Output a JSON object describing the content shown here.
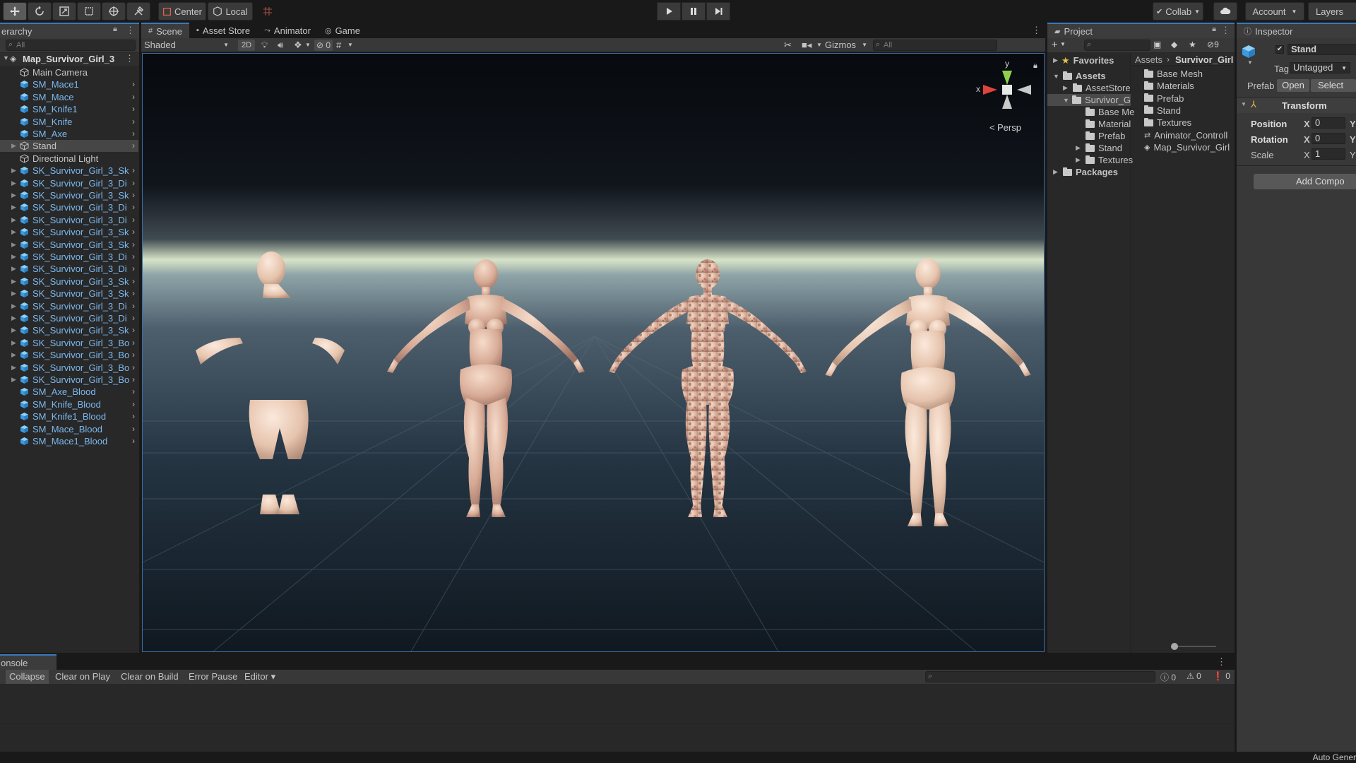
{
  "toolbar": {
    "center_label": "Center",
    "local_label": "Local",
    "collab_label": "Collab",
    "account_label": "Account",
    "layers_label": "Layers"
  },
  "hierarchy": {
    "tab_label": "erarchy",
    "search_placeholder": "All",
    "scene_name": "Map_Survivor_Girl_3",
    "items": [
      {
        "label": "Main Camera",
        "blue": false,
        "expand": false,
        "arrow": false
      },
      {
        "label": "SM_Mace1",
        "blue": true,
        "expand": false,
        "arrow": true
      },
      {
        "label": "SM_Mace",
        "blue": true,
        "expand": false,
        "arrow": true
      },
      {
        "label": "SM_Knife1",
        "blue": true,
        "expand": false,
        "arrow": true
      },
      {
        "label": "SM_Knife",
        "blue": true,
        "expand": false,
        "arrow": true
      },
      {
        "label": "SM_Axe",
        "blue": true,
        "expand": false,
        "arrow": true
      },
      {
        "label": "Stand",
        "blue": false,
        "expand": true,
        "arrow": true,
        "selected": true
      },
      {
        "label": "Directional Light",
        "blue": false,
        "expand": false,
        "arrow": false
      },
      {
        "label": "SK_Survivor_Girl_3_Sk",
        "blue": true,
        "expand": true,
        "arrow": true
      },
      {
        "label": "SK_Survivor_Girl_3_Di",
        "blue": true,
        "expand": true,
        "arrow": true
      },
      {
        "label": "SK_Survivor_Girl_3_Sk",
        "blue": true,
        "expand": true,
        "arrow": true
      },
      {
        "label": "SK_Survivor_Girl_3_Di",
        "blue": true,
        "expand": true,
        "arrow": true
      },
      {
        "label": "SK_Survivor_Girl_3_Di",
        "blue": true,
        "expand": true,
        "arrow": true
      },
      {
        "label": "SK_Survivor_Girl_3_Sk",
        "blue": true,
        "expand": true,
        "arrow": true
      },
      {
        "label": "SK_Survivor_Girl_3_Sk",
        "blue": true,
        "expand": true,
        "arrow": true
      },
      {
        "label": "SK_Survivor_Girl_3_Di",
        "blue": true,
        "expand": true,
        "arrow": true
      },
      {
        "label": "SK_Survivor_Girl_3_Di",
        "blue": true,
        "expand": true,
        "arrow": true
      },
      {
        "label": "SK_Survivor_Girl_3_Sk",
        "blue": true,
        "expand": true,
        "arrow": true
      },
      {
        "label": "SK_Survivor_Girl_3_Sk",
        "blue": true,
        "expand": true,
        "arrow": true
      },
      {
        "label": "SK_Survivor_Girl_3_Di",
        "blue": true,
        "expand": true,
        "arrow": true
      },
      {
        "label": "SK_Survivor_Girl_3_Di",
        "blue": true,
        "expand": true,
        "arrow": true
      },
      {
        "label": "SK_Survivor_Girl_3_Sk",
        "blue": true,
        "expand": true,
        "arrow": true
      },
      {
        "label": "SK_Survivor_Girl_3_Bo",
        "blue": true,
        "expand": true,
        "arrow": true
      },
      {
        "label": "SK_Survivor_Girl_3_Bo",
        "blue": true,
        "expand": true,
        "arrow": true
      },
      {
        "label": "SK_Survivor_Girl_3_Bo",
        "blue": true,
        "expand": true,
        "arrow": true
      },
      {
        "label": "SK_Survivor_Girl_3_Bo",
        "blue": true,
        "expand": true,
        "arrow": true
      },
      {
        "label": "SM_Axe_Blood",
        "blue": true,
        "expand": false,
        "arrow": true
      },
      {
        "label": "SM_Knife_Blood",
        "blue": true,
        "expand": false,
        "arrow": true
      },
      {
        "label": "SM_Knife1_Blood",
        "blue": true,
        "expand": false,
        "arrow": true
      },
      {
        "label": "SM_Mace_Blood",
        "blue": true,
        "expand": false,
        "arrow": true
      },
      {
        "label": "SM_Mace1_Blood",
        "blue": true,
        "expand": false,
        "arrow": true
      }
    ]
  },
  "scene": {
    "tabs": [
      {
        "label": "Scene",
        "icon": "#",
        "selected": true
      },
      {
        "label": "Asset Store",
        "icon": "▪",
        "selected": false
      },
      {
        "label": "Animator",
        "icon": "⤳",
        "selected": false
      },
      {
        "label": "Game",
        "icon": "◎",
        "selected": false
      }
    ],
    "shading_mode": "Shaded",
    "mode_2d": "2D",
    "hidden_count": "0",
    "gizmos_label": "Gizmos",
    "search_placeholder": "All",
    "gizmo_y": "y",
    "gizmo_x": "x",
    "persp_label": "Persp"
  },
  "project": {
    "tab_label": "Project",
    "hidden_count": "9",
    "favorites_label": "Favorites",
    "tree": [
      {
        "label": "Assets",
        "bold": true
      },
      {
        "label": "AssetStore",
        "bold": false
      },
      {
        "label": "Survivor_G",
        "bold": false,
        "selected": true
      },
      {
        "label": "Base Me",
        "bold": false
      },
      {
        "label": "Material",
        "bold": false
      },
      {
        "label": "Prefab",
        "bold": false
      },
      {
        "label": "Stand",
        "bold": false
      },
      {
        "label": "Textures",
        "bold": false
      },
      {
        "label": "Packages",
        "bold": true
      }
    ],
    "breadcrumb_root": "Assets",
    "breadcrumb_current": "Survivor_Girl",
    "files": [
      {
        "label": "Base Mesh",
        "kind": "folder"
      },
      {
        "label": "Materials",
        "kind": "folder"
      },
      {
        "label": "Prefab",
        "kind": "folder"
      },
      {
        "label": "Stand",
        "kind": "folder"
      },
      {
        "label": "Textures",
        "kind": "folder"
      },
      {
        "label": "Animator_Controll",
        "kind": "animator"
      },
      {
        "label": "Map_Survivor_Girl",
        "kind": "scene"
      }
    ]
  },
  "inspector": {
    "tab_label": "Inspector",
    "object_name": "Stand",
    "tag_label": "Tag",
    "tag_value": "Untagged",
    "prefab_label": "Prefab",
    "open_label": "Open",
    "select_label": "Select",
    "transform_label": "Transform",
    "position_label": "Position",
    "rotation_label": "Rotation",
    "scale_label": "Scale",
    "axis_x": "X",
    "axis_y": "Y",
    "position_x": "0",
    "rotation_x": "0",
    "scale_x": "1",
    "add_component_label": "Add Compo"
  },
  "console": {
    "tab_label": "onsole",
    "buttons": [
      "Collapse",
      "Clear on Play",
      "Clear on Build",
      "Error Pause",
      "Editor"
    ],
    "info_count": "0",
    "warning_count": "0",
    "error_count": "0"
  },
  "status_bar": {
    "text": "Auto Gener"
  }
}
